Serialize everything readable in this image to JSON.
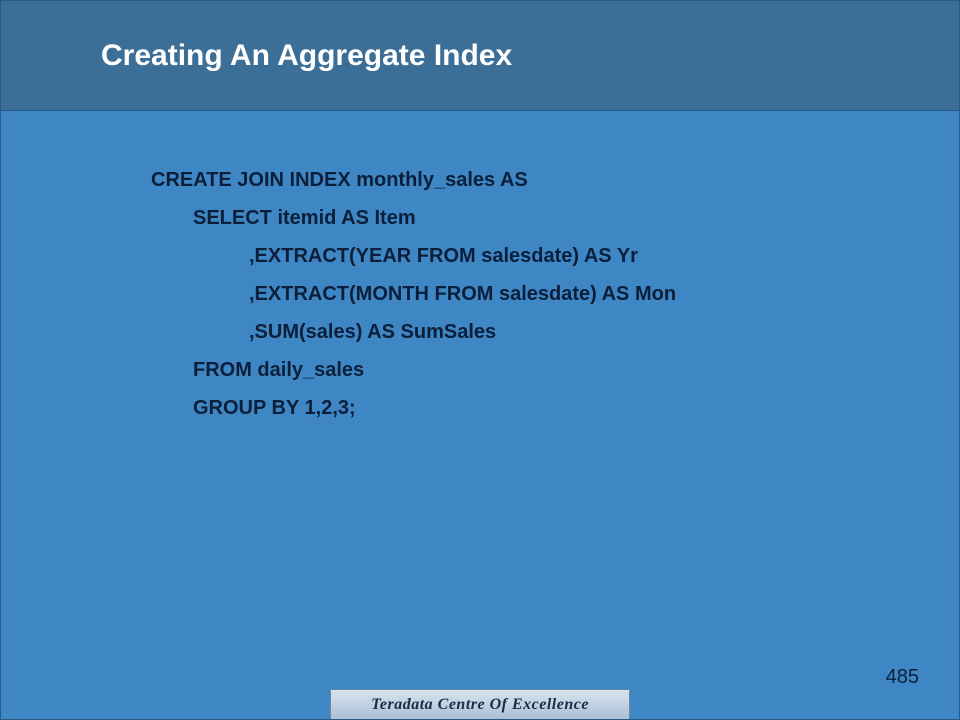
{
  "title": "Creating An Aggregate Index",
  "code": {
    "line1": "CREATE JOIN INDEX monthly_sales AS",
    "line2": "SELECT itemid AS Item",
    "line3": ",EXTRACT(YEAR FROM salesdate) AS Yr",
    "line4": ",EXTRACT(MONTH FROM salesdate) AS Mon",
    "line5": ",SUM(sales) AS SumSales",
    "line6": "FROM daily_sales",
    "line7": "GROUP BY 1,2,3;"
  },
  "page_number": "485",
  "footer": "Teradata Centre Of Excellence"
}
